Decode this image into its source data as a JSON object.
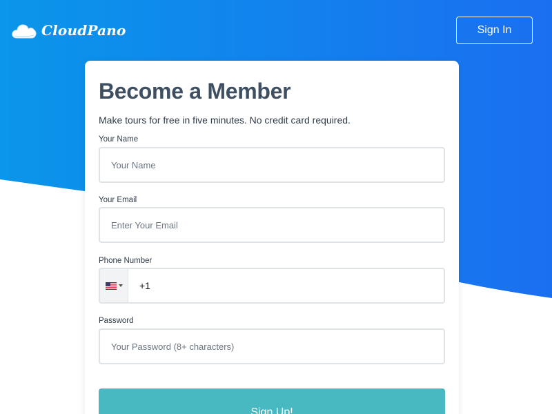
{
  "brand": {
    "name": "CloudPano",
    "logo_icon": "cloud-icon"
  },
  "header": {
    "signin_label": "Sign In"
  },
  "form": {
    "title": "Become a Member",
    "subtitle": "Make tours for free in five minutes. No credit card required.",
    "name": {
      "label": "Your Name",
      "placeholder": "Your Name",
      "value": ""
    },
    "email": {
      "label": "Your Email",
      "placeholder": "Enter Your Email",
      "value": ""
    },
    "phone": {
      "label": "Phone Number",
      "country_icon": "us-flag-icon",
      "value": "+1"
    },
    "password": {
      "label": "Password",
      "placeholder": "Your Password (8+ characters)",
      "value": ""
    },
    "submit_label": "Sign Up!"
  },
  "colors": {
    "hero_gradient_start": "#0a96ea",
    "hero_gradient_end": "#1a6ff0",
    "title_text": "#3d4f61",
    "submit_button": "#49b9c1",
    "field_border": "#dde3e6"
  }
}
